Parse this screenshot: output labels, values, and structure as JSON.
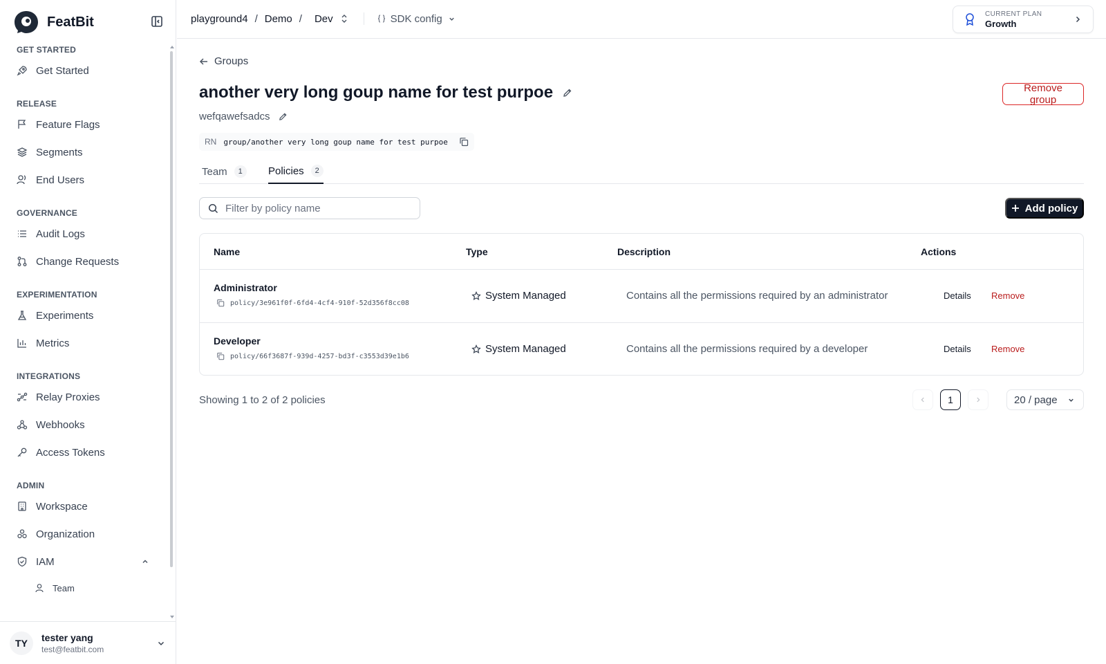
{
  "brand": {
    "name": "FeatBit"
  },
  "sidebar": {
    "sections": [
      {
        "title": "GET STARTED",
        "items": [
          {
            "label": "Get Started",
            "icon": "rocket-icon"
          }
        ]
      },
      {
        "title": "RELEASE",
        "items": [
          {
            "label": "Feature Flags",
            "icon": "flag-icon"
          },
          {
            "label": "Segments",
            "icon": "layers-icon"
          },
          {
            "label": "End Users",
            "icon": "users-icon"
          }
        ]
      },
      {
        "title": "GOVERNANCE",
        "items": [
          {
            "label": "Audit Logs",
            "icon": "list-icon"
          },
          {
            "label": "Change Requests",
            "icon": "git-pull-request-icon"
          }
        ]
      },
      {
        "title": "EXPERIMENTATION",
        "items": [
          {
            "label": "Experiments",
            "icon": "flask-icon"
          },
          {
            "label": "Metrics",
            "icon": "bar-chart-icon"
          }
        ]
      },
      {
        "title": "INTEGRATIONS",
        "items": [
          {
            "label": "Relay Proxies",
            "icon": "relay-icon"
          },
          {
            "label": "Webhooks",
            "icon": "webhook-icon"
          },
          {
            "label": "Access Tokens",
            "icon": "key-icon"
          }
        ]
      },
      {
        "title": "ADMIN",
        "items": [
          {
            "label": "Workspace",
            "icon": "building-icon"
          },
          {
            "label": "Organization",
            "icon": "organization-icon"
          },
          {
            "label": "IAM",
            "icon": "shield-icon"
          }
        ]
      }
    ],
    "iam_sub": {
      "label": "Team"
    }
  },
  "user": {
    "initials": "TY",
    "name": "tester yang",
    "email": "test@featbit.com"
  },
  "topbar": {
    "project": "playground4",
    "sep1": "/",
    "environment_group": "Demo",
    "sep2": "/",
    "environment": "Dev",
    "sdk_config": "SDK config"
  },
  "plan": {
    "label": "CURRENT PLAN",
    "value": "Growth"
  },
  "page": {
    "back_label": "Groups",
    "title": "another very long goup name for test purpoe",
    "description": "wefqawefsadcs",
    "rn_label": "RN",
    "rn_value": "group/another very long goup name for test purpoe",
    "remove_group_label": "Remove group"
  },
  "tabs": [
    {
      "label": "Team",
      "count": "1"
    },
    {
      "label": "Policies",
      "count": "2"
    }
  ],
  "filter": {
    "placeholder": "Filter by policy name",
    "value": ""
  },
  "add_policy_label": "Add policy",
  "table": {
    "columns": [
      "Name",
      "Type",
      "Description",
      "Actions"
    ],
    "rows": [
      {
        "name": "Administrator",
        "rn": "policy/3e961f0f-6fd4-4cf4-910f-52d356f8cc08",
        "type": "System Managed",
        "description": "Contains all the permissions required by an administrator",
        "details": "Details",
        "remove": "Remove"
      },
      {
        "name": "Developer",
        "rn": "policy/66f3687f-939d-4257-bd3f-c3553d39e1b6",
        "type": "System Managed",
        "description": "Contains all the permissions required by a developer",
        "details": "Details",
        "remove": "Remove"
      }
    ]
  },
  "pagination": {
    "summary": "Showing 1 to 2 of 2 policies",
    "current_page": "1",
    "page_size": "20 / page"
  },
  "colors": {
    "primary": "#111827",
    "danger": "#b91c1c",
    "border": "#e5e7eb",
    "muted_text": "#4b5563"
  }
}
